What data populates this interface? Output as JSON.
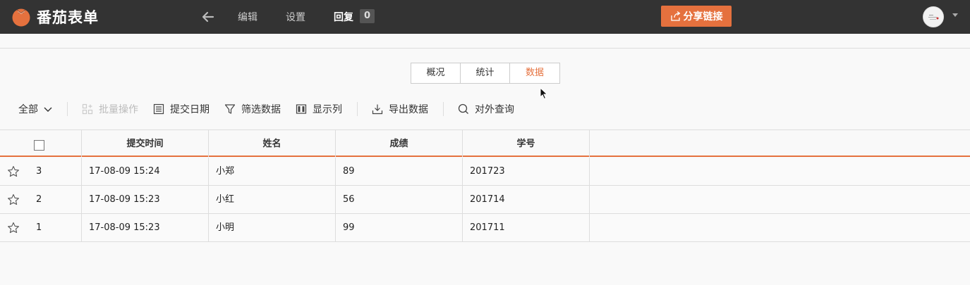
{
  "app": {
    "name": "番茄表单"
  },
  "nav": {
    "edit": "编辑",
    "settings": "设置",
    "replies": "回复",
    "reply_count": "0"
  },
  "share": {
    "label": "分享链接"
  },
  "tabs": [
    {
      "label": "概况",
      "active": false
    },
    {
      "label": "统计",
      "active": false
    },
    {
      "label": "数据",
      "active": true
    }
  ],
  "toolbar": {
    "filter_all": "全部",
    "batch": "批量操作",
    "submit_date": "提交日期",
    "filter_data": "筛选数据",
    "show_columns": "显示列",
    "export": "导出数据",
    "public_query": "对外查询"
  },
  "table": {
    "columns": [
      "提交时间",
      "姓名",
      "成绩",
      "学号"
    ],
    "rows": [
      {
        "num": "3",
        "time": "17-08-09 15:24",
        "name": "小郑",
        "score": "89",
        "id": "201723"
      },
      {
        "num": "2",
        "time": "17-08-09 15:23",
        "name": "小红",
        "score": "56",
        "id": "201714"
      },
      {
        "num": "1",
        "time": "17-08-09 15:23",
        "name": "小明",
        "score": "99",
        "id": "201711"
      }
    ]
  },
  "colors": {
    "accent": "#e5713e",
    "topbar": "#333333"
  }
}
